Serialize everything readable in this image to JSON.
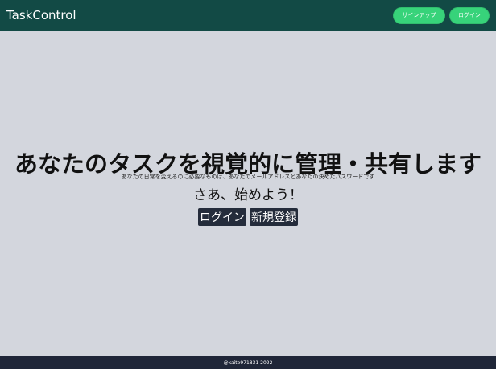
{
  "header": {
    "brand": "TaskControl",
    "signup_label": "サインアップ",
    "login_label": "ログイン"
  },
  "hero": {
    "headline": "あなたのタスクを視覚的に管理・共有します",
    "subline": "あなたの日常を変えるのに必要なものは、あなたのメールアドレスとあなたの決めたパスワードです",
    "start_text": "さあ、始めよう！",
    "login_button": "ログイン",
    "register_button": "新規登録"
  },
  "footer": {
    "copyright": "@kaito971831 2022"
  },
  "colors": {
    "header_bg": "#124a45",
    "accent_green": "#37d37a",
    "page_bg": "#d3d6dd",
    "dark_button": "#242c3b",
    "footer_bg": "#1f2638"
  }
}
